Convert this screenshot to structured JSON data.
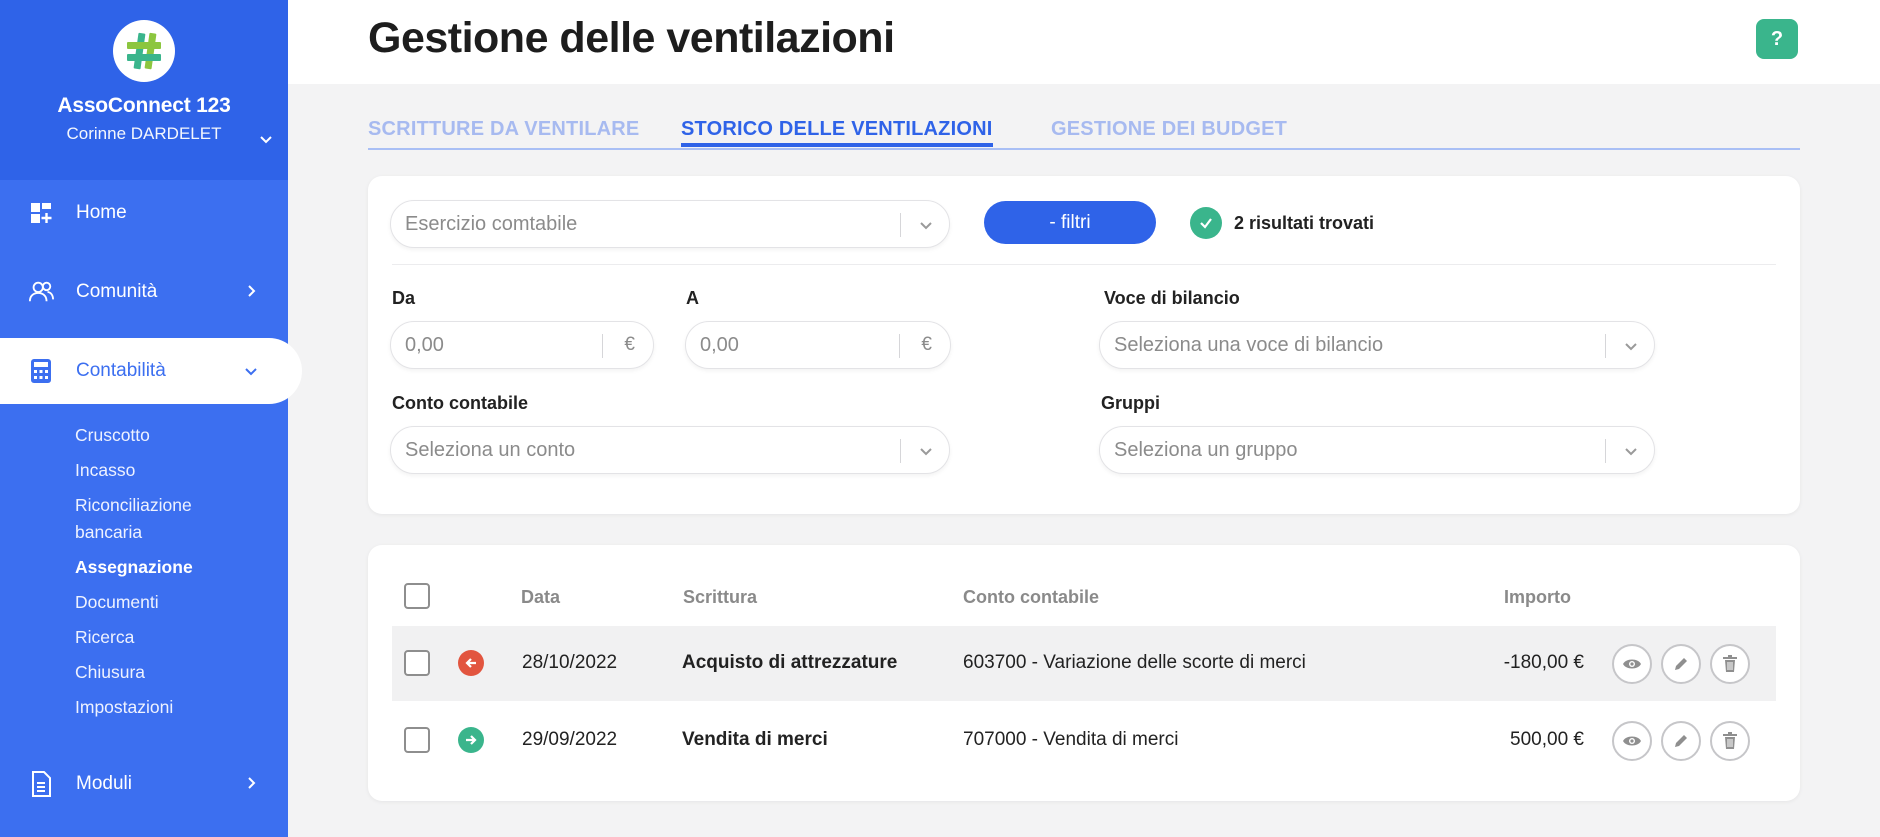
{
  "org": {
    "name": "AssoConnect 123",
    "user": "Corinne DARDELET"
  },
  "nav": {
    "home": "Home",
    "community": "Comunità",
    "accounting": "Contabilità",
    "modules": "Moduli"
  },
  "submenu": [
    "Cruscotto",
    "Incasso",
    "Riconciliazione bancaria",
    "Assegnazione",
    "Documenti",
    "Ricerca",
    "Chiusura",
    "Impostazioni"
  ],
  "page": {
    "title": "Gestione delle ventilazioni",
    "help": "?"
  },
  "tabs": [
    "SCRITTURE DA VENTILARE",
    "STORICO DELLE VENTILAZIONI",
    "GESTIONE DEI BUDGET"
  ],
  "filters": {
    "fiscal_year_placeholder": "Esercizio comtabile",
    "filter_button": "- filtri",
    "results_text": "2 risultati trovati",
    "from_label": "Da",
    "from_value": "0,00",
    "to_label": "A",
    "to_value": "0,00",
    "currency": "€",
    "budget_label": "Voce di bilancio",
    "budget_placeholder": "Seleziona una voce di bilancio",
    "account_label": "Conto contabile",
    "account_placeholder": "Seleziona un conto",
    "groups_label": "Gruppi",
    "groups_placeholder": "Seleziona un gruppo"
  },
  "table": {
    "headers": {
      "date": "Data",
      "entry": "Scrittura",
      "account": "Conto contabile",
      "amount": "Importo"
    },
    "rows": [
      {
        "direction": "out",
        "date": "28/10/2022",
        "entry": "Acquisto di attrezzature",
        "account": "603700 - Variazione delle scorte di merci",
        "amount": "-180,00 €"
      },
      {
        "direction": "in",
        "date": "29/09/2022",
        "entry": "Vendita di merci",
        "account": "707000 - Vendita di merci",
        "amount": "500,00 €"
      }
    ]
  },
  "colors": {
    "brand_blue": "#2f63e8",
    "sidebar_blue": "#3c6ff0",
    "green": "#3ab58c",
    "red": "#e2553f"
  }
}
